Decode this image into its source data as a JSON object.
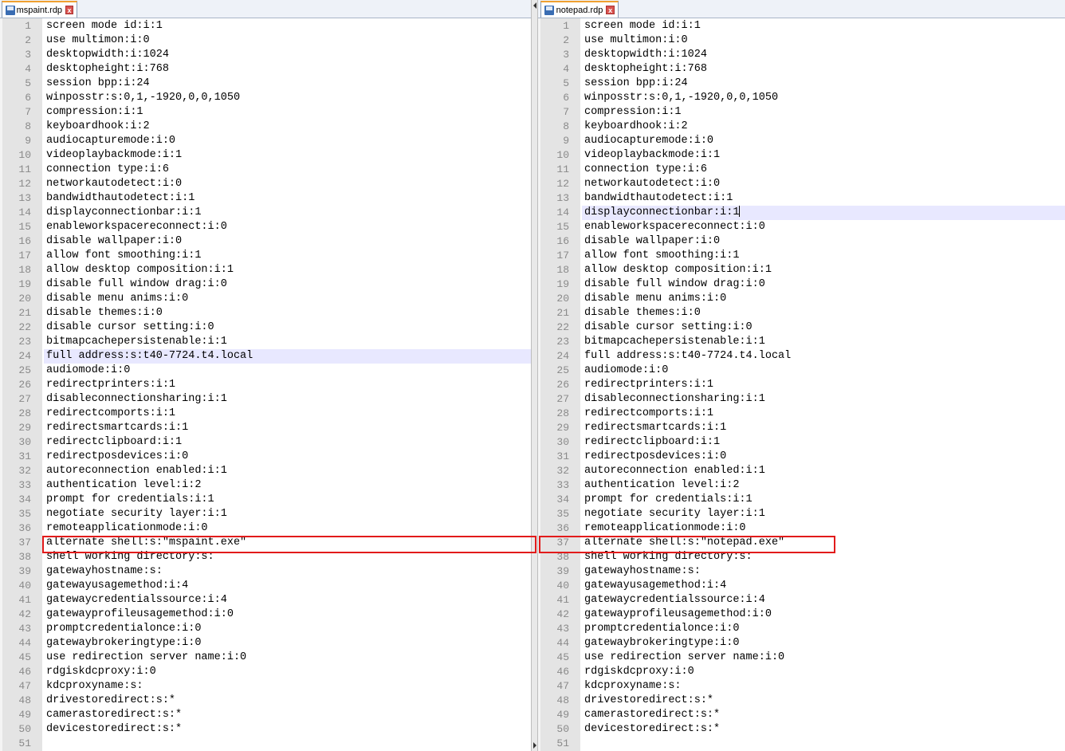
{
  "left": {
    "tab": {
      "label": "mspaint.rdp",
      "close": "x"
    },
    "highlight_line": 24,
    "lines": [
      "screen mode id:i:1",
      "use multimon:i:0",
      "desktopwidth:i:1024",
      "desktopheight:i:768",
      "session bpp:i:24",
      "winposstr:s:0,1,-1920,0,0,1050",
      "compression:i:1",
      "keyboardhook:i:2",
      "audiocapturemode:i:0",
      "videoplaybackmode:i:1",
      "connection type:i:6",
      "networkautodetect:i:0",
      "bandwidthautodetect:i:1",
      "displayconnectionbar:i:1",
      "enableworkspacereconnect:i:0",
      "disable wallpaper:i:0",
      "allow font smoothing:i:1",
      "allow desktop composition:i:1",
      "disable full window drag:i:0",
      "disable menu anims:i:0",
      "disable themes:i:0",
      "disable cursor setting:i:0",
      "bitmapcachepersistenable:i:1",
      "full address:s:t40-7724.t4.local",
      "audiomode:i:0",
      "redirectprinters:i:1",
      "disableconnectionsharing:i:1",
      "redirectcomports:i:1",
      "redirectsmartcards:i:1",
      "redirectclipboard:i:1",
      "redirectposdevices:i:0",
      "autoreconnection enabled:i:1",
      "authentication level:i:2",
      "prompt for credentials:i:1",
      "negotiate security layer:i:1",
      "remoteapplicationmode:i:0",
      "alternate shell:s:\"mspaint.exe\"",
      "shell working directory:s:",
      "gatewayhostname:s:",
      "gatewayusagemethod:i:4",
      "gatewaycredentialssource:i:4",
      "gatewayprofileusagemethod:i:0",
      "promptcredentialonce:i:0",
      "gatewaybrokeringtype:i:0",
      "use redirection server name:i:0",
      "rdgiskdcproxy:i:0",
      "kdcproxyname:s:",
      "drivestoredirect:s:*",
      "camerastoredirect:s:*",
      "devicestoredirect:s:*",
      ""
    ]
  },
  "right": {
    "tab": {
      "label": "notepad.rdp",
      "close": "x"
    },
    "highlight_line": 14,
    "lines": [
      "screen mode id:i:1",
      "use multimon:i:0",
      "desktopwidth:i:1024",
      "desktopheight:i:768",
      "session bpp:i:24",
      "winposstr:s:0,1,-1920,0,0,1050",
      "compression:i:1",
      "keyboardhook:i:2",
      "audiocapturemode:i:0",
      "videoplaybackmode:i:1",
      "connection type:i:6",
      "networkautodetect:i:0",
      "bandwidthautodetect:i:1",
      "displayconnectionbar:i:1",
      "enableworkspacereconnect:i:0",
      "disable wallpaper:i:0",
      "allow font smoothing:i:1",
      "allow desktop composition:i:1",
      "disable full window drag:i:0",
      "disable menu anims:i:0",
      "disable themes:i:0",
      "disable cursor setting:i:0",
      "bitmapcachepersistenable:i:1",
      "full address:s:t40-7724.t4.local",
      "audiomode:i:0",
      "redirectprinters:i:1",
      "disableconnectionsharing:i:1",
      "redirectcomports:i:1",
      "redirectsmartcards:i:1",
      "redirectclipboard:i:1",
      "redirectposdevices:i:0",
      "autoreconnection enabled:i:1",
      "authentication level:i:2",
      "prompt for credentials:i:1",
      "negotiate security layer:i:1",
      "remoteapplicationmode:i:0",
      "alternate shell:s:\"notepad.exe\"",
      "shell working directory:s:",
      "gatewayhostname:s:",
      "gatewayusagemethod:i:4",
      "gatewaycredentialssource:i:4",
      "gatewayprofileusagemethod:i:0",
      "promptcredentialonce:i:0",
      "gatewaybrokeringtype:i:0",
      "use redirection server name:i:0",
      "rdgiskdcproxy:i:0",
      "kdcproxyname:s:",
      "drivestoredirect:s:*",
      "camerastoredirect:s:*",
      "devicestoredirect:s:*",
      ""
    ]
  },
  "annotation": {
    "color": "#e21b1b",
    "line": 37
  }
}
